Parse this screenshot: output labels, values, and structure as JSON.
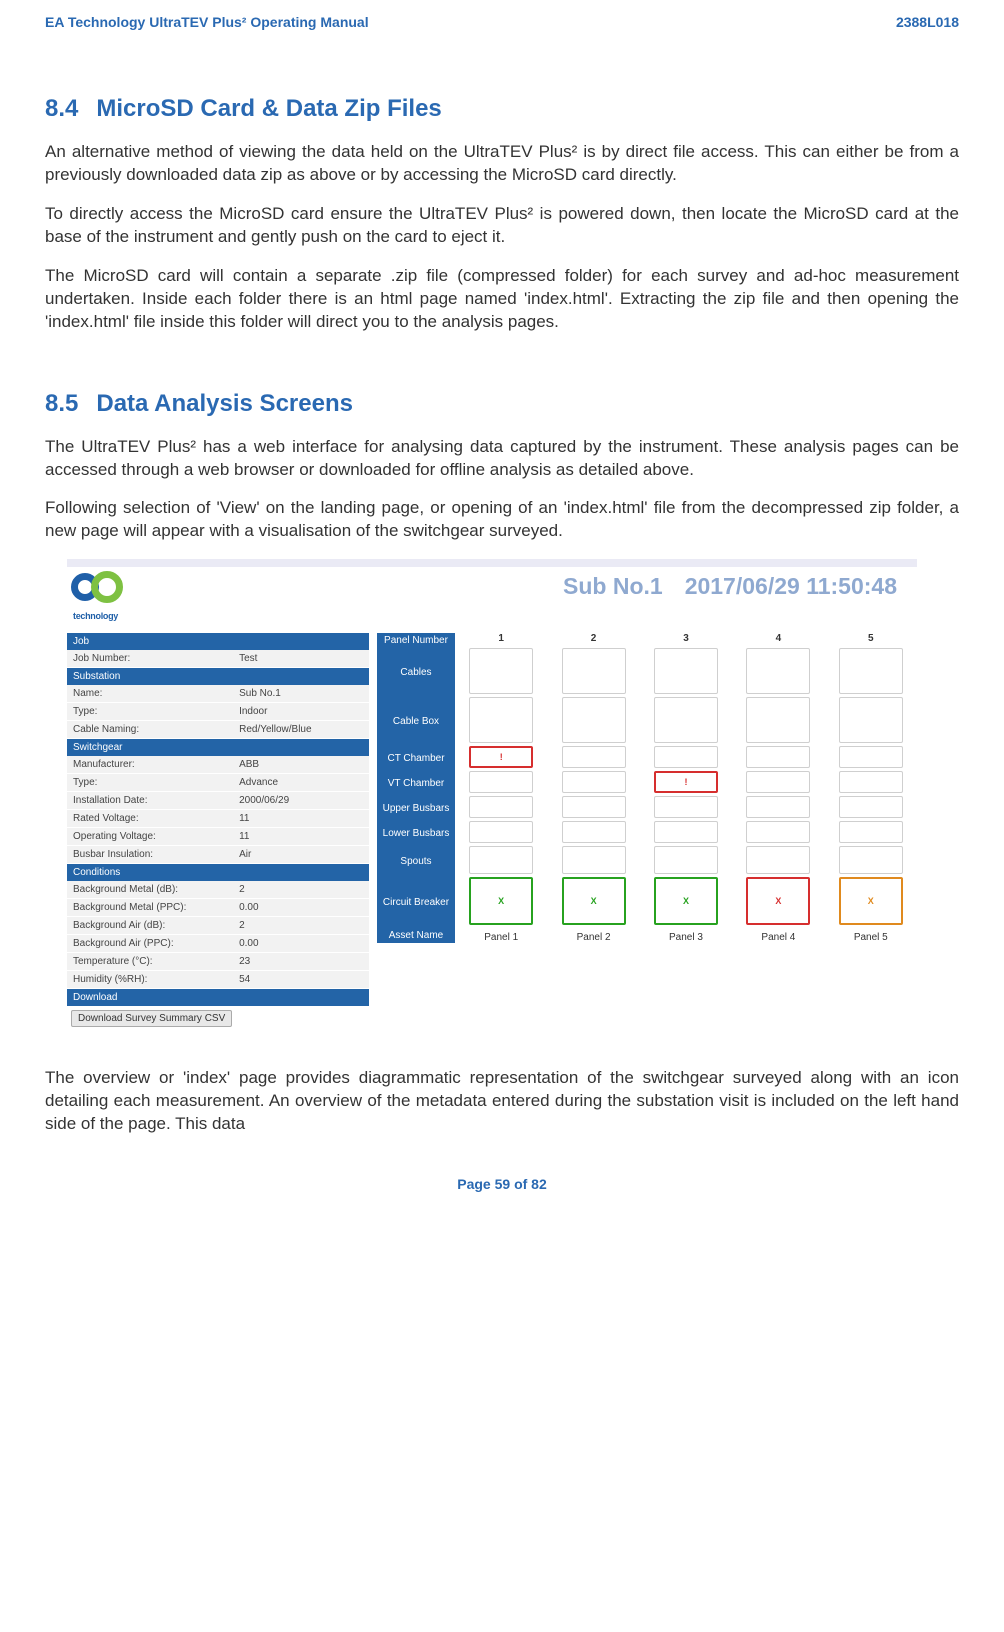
{
  "header": {
    "left": "EA Technology UltraTEV Plus² Operating Manual",
    "right": "2388L018"
  },
  "sec84": {
    "num": "8.4",
    "title": "MicroSD Card & Data Zip Files",
    "p1": "An alternative method of viewing the data held on the UltraTEV Plus² is by direct file access. This can either be from a previously downloaded data zip as above or by accessing the MicroSD card directly.",
    "p2": "To directly access the MicroSD card ensure the UltraTEV Plus² is powered down, then locate the MicroSD card at the base of the instrument and gently push on the card to eject it.",
    "p3": "The MicroSD card will contain a separate .zip file (compressed folder) for each survey and ad-hoc measurement undertaken. Inside each folder there is an html page named 'index.html'. Extracting the zip file and then opening the 'index.html' file inside this folder will direct you to the analysis pages."
  },
  "sec85": {
    "num": "8.5",
    "title": "Data Analysis Screens",
    "p1": "The UltraTEV Plus² has a web interface for analysing data captured by the instrument. These analysis pages can be accessed through a web browser or downloaded for offline analysis as detailed above.",
    "p2": "Following selection of 'View' on the landing page, or opening of an 'index.html' file from the decompressed zip folder, a new page will appear with a visualisation of the switchgear surveyed.",
    "p3": "The overview or 'index' page provides diagrammatic representation of the switchgear surveyed along with an icon detailing each measurement. An overview of the metadata entered during the substation visit is included on the left hand side of the page. This data"
  },
  "figure": {
    "logo_text": "technology",
    "title_sub": "Sub No.1",
    "title_date": "2017/06/29 11:50:48",
    "side": {
      "job_h": "Job",
      "job_k": "Job Number:",
      "job_v": "Test",
      "sub_h": "Substation",
      "name_k": "Name:",
      "name_v": "Sub No.1",
      "type_k": "Type:",
      "type_v": "Indoor",
      "cable_k": "Cable Naming:",
      "cable_v": "Red/Yellow/Blue",
      "sw_h": "Switchgear",
      "mfr_k": "Manufacturer:",
      "mfr_v": "ABB",
      "swtype_k": "Type:",
      "swtype_v": "Advance",
      "inst_k": "Installation Date:",
      "inst_v": "2000/06/29",
      "rated_k": "Rated Voltage:",
      "rated_v": "11",
      "opv_k": "Operating Voltage:",
      "opv_v": "11",
      "bus_k": "Busbar Insulation:",
      "bus_v": "Air",
      "cond_h": "Conditions",
      "bgmdb_k": "Background Metal (dB):",
      "bgmdb_v": "2",
      "bgmppc_k": "Background Metal (PPC):",
      "bgmppc_v": "0.00",
      "bgadb_k": "Background Air (dB):",
      "bgadb_v": "2",
      "bgappc_k": "Background Air (PPC):",
      "bgappc_v": "0.00",
      "temp_k": "Temperature (°C):",
      "temp_v": "23",
      "hum_k": "Humidity (%RH):",
      "hum_v": "54",
      "dl_h": "Download",
      "dl_btn": "Download Survey Summary CSV"
    },
    "rows": {
      "panel_num": "Panel Number",
      "cables": "Cables",
      "cablebox": "Cable Box",
      "ct": "CT Chamber",
      "vt": "VT Chamber",
      "ub": "Upper Busbars",
      "lb": "Lower Busbars",
      "spouts": "Spouts",
      "cb": "Circuit Breaker",
      "asset": "Asset Name"
    },
    "cols": {
      "c1": "1",
      "c2": "2",
      "c3": "3",
      "c4": "4",
      "c5": "5"
    },
    "assets": {
      "a1": "Panel 1",
      "a2": "Panel 2",
      "a3": "Panel 3",
      "a4": "Panel 4",
      "a5": "Panel 5"
    }
  },
  "footer": "Page 59 of 82"
}
